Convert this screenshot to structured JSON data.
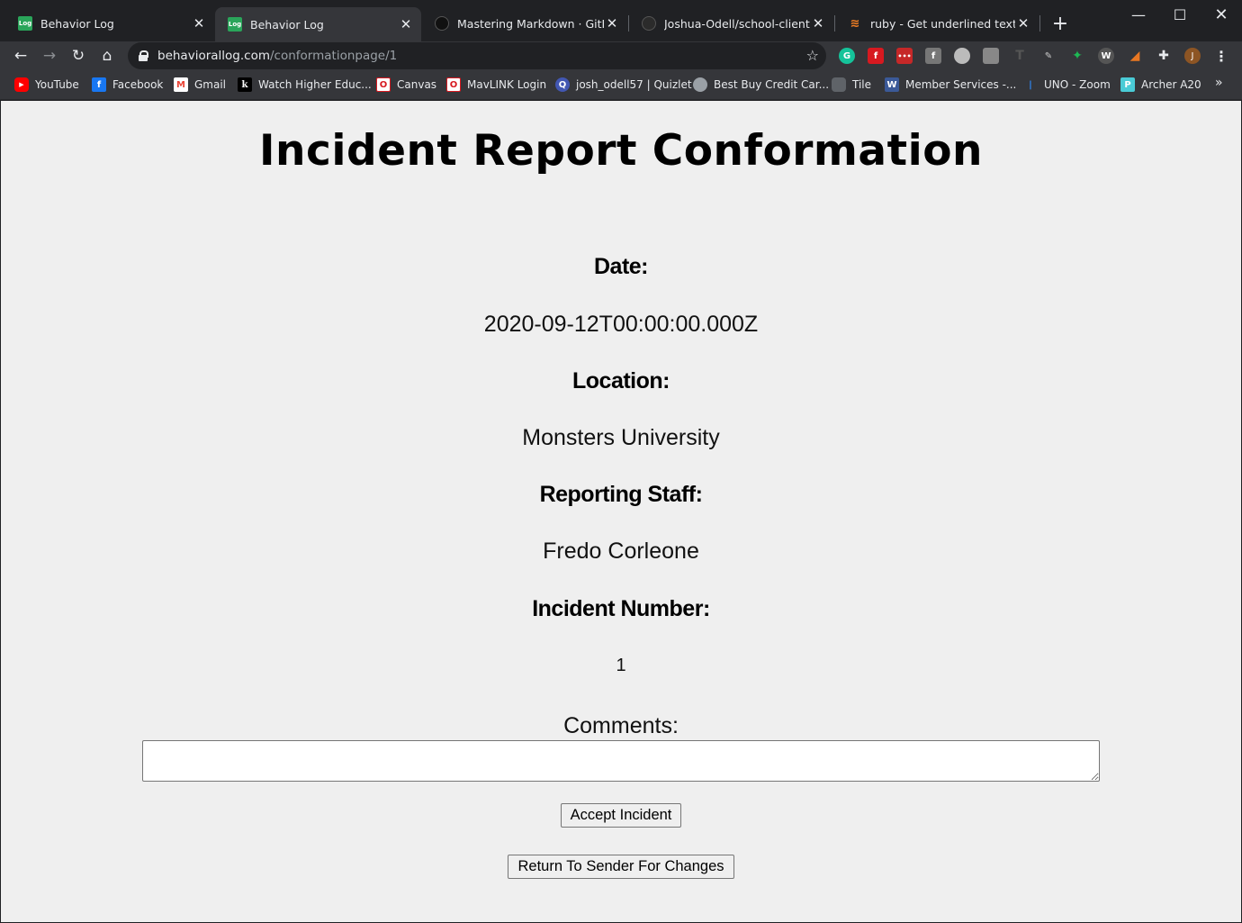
{
  "browser": {
    "tabs": [
      {
        "title": "Behavior Log",
        "icon": "log-favicon"
      },
      {
        "title": "Behavior Log",
        "icon": "log-favicon",
        "active": true
      },
      {
        "title": "Mastering Markdown · GitHub",
        "icon": "github-favicon"
      },
      {
        "title": "Joshua-Odell/school-client",
        "icon": "github-favicon"
      },
      {
        "title": "ruby - Get underlined text with",
        "icon": "stackoverflow-favicon"
      }
    ],
    "favicon_text": "Log",
    "address": {
      "domain": "behaviorallog.com",
      "path": "/conformationpage/1"
    },
    "profile_initial": "J",
    "bookmarks": [
      {
        "label": "YouTube",
        "icon": "youtube-icon",
        "color": "#ff0000"
      },
      {
        "label": "Facebook",
        "icon": "facebook-icon",
        "color": "#1877f2"
      },
      {
        "label": "Gmail",
        "icon": "gmail-icon",
        "color": "#ea4335"
      },
      {
        "label": "Watch Higher Educ...",
        "icon": "kanopy-icon",
        "color": "#000000"
      },
      {
        "label": "Canvas",
        "icon": "unomaha-icon",
        "color": "#d71920"
      },
      {
        "label": "MavLINK Login",
        "icon": "unomaha-icon",
        "color": "#d71920"
      },
      {
        "label": "josh_odell57 | Quizlet",
        "icon": "quizlet-icon",
        "color": "#4257b2"
      },
      {
        "label": "Best Buy Credit Car...",
        "icon": "globe-icon",
        "color": "#9aa0a6"
      },
      {
        "label": "Tile",
        "icon": "tile-icon",
        "color": "#5f6368"
      },
      {
        "label": "Member Services -...",
        "icon": "member-services-icon",
        "color": "#3b5998"
      },
      {
        "label": "UNO - Zoom",
        "icon": "zoom-icon",
        "color": "#2d8cff"
      },
      {
        "label": "Archer A20",
        "icon": "tplink-icon",
        "color": "#4acbd6"
      }
    ]
  },
  "page": {
    "title": "Incident Report Conformation",
    "fields": [
      {
        "label": "Date:",
        "value": "2020-09-12T00:00:00.000Z"
      },
      {
        "label": "Location:",
        "value": "Monsters University"
      },
      {
        "label": "Reporting Staff:",
        "value": "Fredo Corleone"
      },
      {
        "label": "Incident Number:",
        "value": "1"
      }
    ],
    "comments_label": "Comments:",
    "comments_value": "",
    "accept_button": "Accept Incident",
    "return_button": "Return To Sender For Changes"
  }
}
